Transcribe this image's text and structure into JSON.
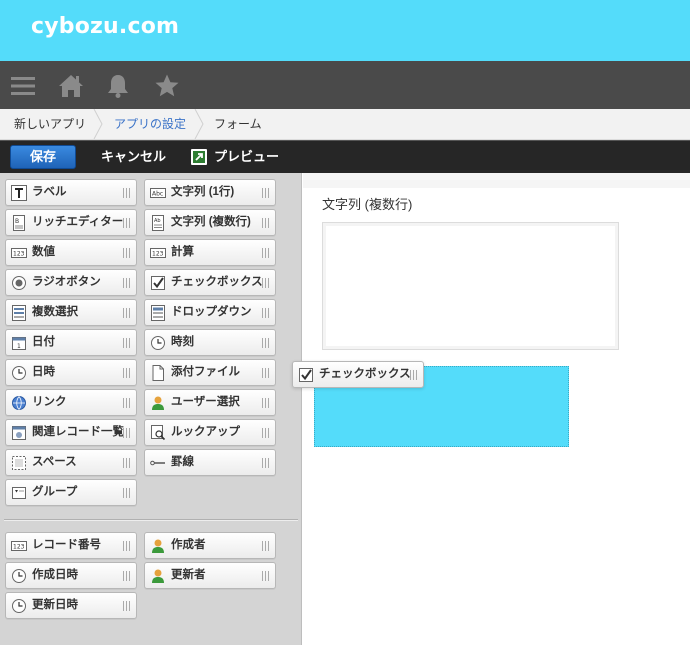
{
  "header": {
    "logo": "cybozu.com",
    "color": "#54dcfa"
  },
  "nav": {
    "icons": [
      "menu-icon",
      "home-icon",
      "bell-icon",
      "star-icon"
    ]
  },
  "breadcrumb": {
    "items": [
      "新しいアプリ",
      "アプリの設定",
      "フォーム"
    ]
  },
  "toolbar": {
    "save": "保存",
    "cancel": "キャンセル",
    "preview": "プレビュー"
  },
  "palette": {
    "fields": [
      {
        "label": "ラベル",
        "icon": "label-icon"
      },
      {
        "label": "文字列 (1行)",
        "icon": "single-line-text-icon"
      },
      {
        "label": "リッチエディター",
        "icon": "rich-editor-icon"
      },
      {
        "label": "文字列 (複数行)",
        "icon": "multi-line-text-icon"
      },
      {
        "label": "数値",
        "icon": "number-icon"
      },
      {
        "label": "計算",
        "icon": "calc-icon"
      },
      {
        "label": "ラジオボタン",
        "icon": "radio-icon"
      },
      {
        "label": "チェックボックス",
        "icon": "checkbox-icon"
      },
      {
        "label": "複数選択",
        "icon": "multi-select-icon"
      },
      {
        "label": "ドロップダウン",
        "icon": "dropdown-icon"
      },
      {
        "label": "日付",
        "icon": "calendar-icon"
      },
      {
        "label": "時刻",
        "icon": "clock-icon"
      },
      {
        "label": "日時",
        "icon": "clock-icon"
      },
      {
        "label": "添付ファイル",
        "icon": "file-icon"
      },
      {
        "label": "リンク",
        "icon": "globe-icon"
      },
      {
        "label": "ユーザー選択",
        "icon": "user-icon"
      },
      {
        "label": "関連レコード一覧",
        "icon": "related-records-icon"
      },
      {
        "label": "ルックアップ",
        "icon": "lookup-icon"
      },
      {
        "label": "スペース",
        "icon": "space-icon"
      },
      {
        "label": "罫線",
        "icon": "line-icon"
      },
      {
        "label": "グループ",
        "icon": "group-icon"
      }
    ],
    "system_fields": [
      {
        "label": "レコード番号",
        "icon": "number-icon"
      },
      {
        "label": "作成者",
        "icon": "user-icon"
      },
      {
        "label": "作成日時",
        "icon": "clock-icon"
      },
      {
        "label": "更新者",
        "icon": "user-icon"
      },
      {
        "label": "更新日時",
        "icon": "clock-icon"
      }
    ]
  },
  "form": {
    "field_label": "文字列 (複数行)",
    "dragging_item": "チェックボックス",
    "drop_zone_color": "#54dcfa"
  }
}
